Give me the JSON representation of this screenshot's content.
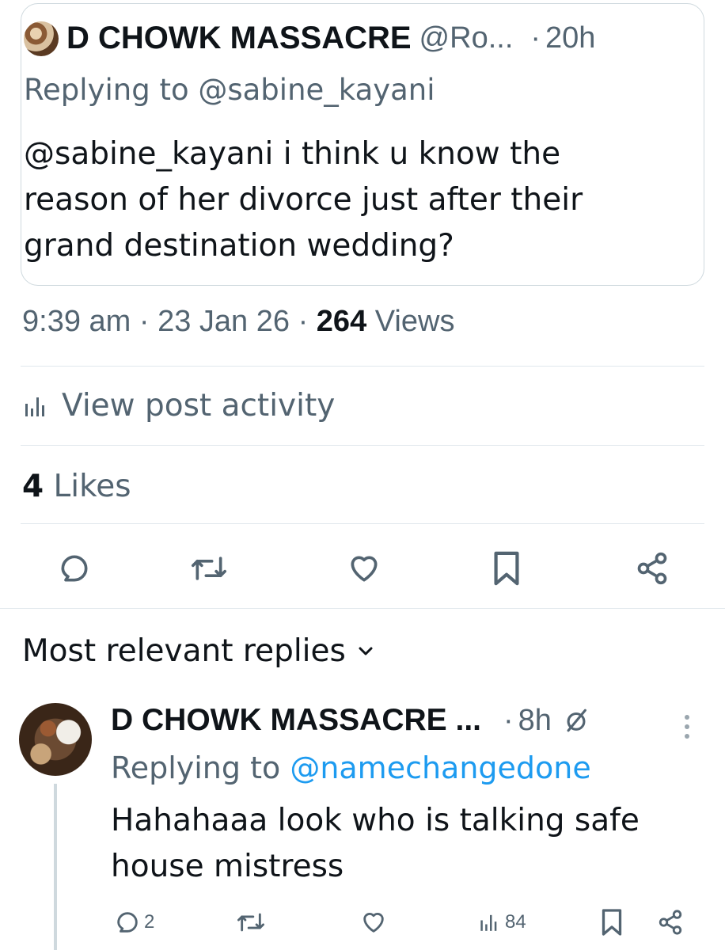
{
  "quoted_post": {
    "author_name": "D CHOWK MASSACRE",
    "author_handle": "@Ro...",
    "separator": "·",
    "time": "20h",
    "replying_prefix": "Replying to ",
    "replying_handle": "@sabine_kayani",
    "body": "@sabine_kayani i think u know the reason of her divorce just after their grand destination wedding?"
  },
  "post_meta": {
    "time": "9:39 am",
    "sep1": " · ",
    "date": "23 Jan 26",
    "sep2": " · ",
    "views_count": "264",
    "views_label": " Views"
  },
  "activity": {
    "label": "View post activity",
    "icon": "analytics-icon"
  },
  "likes": {
    "count": "4",
    "label": " Likes"
  },
  "actions": {
    "reply_icon": "reply-icon",
    "repost_icon": "repost-icon",
    "like_icon": "heart-icon",
    "bookmark_icon": "bookmark-icon",
    "share_icon": "share-icon"
  },
  "replies_sort": {
    "label": "Most relevant replies"
  },
  "reply": {
    "author_name": "D CHOWK MASSACRE ...",
    "separator": "·",
    "time": "8h",
    "replying_prefix": "Replying to ",
    "replying_handle": "@namechangedone",
    "body": "Hahahaaa look who is talking safe house mistress",
    "reply_count": "2",
    "views_count": "84"
  },
  "colors": {
    "text_primary": "#0f1419",
    "text_secondary": "#536471",
    "link": "#1d9bf0",
    "border": "#cfd9de"
  }
}
